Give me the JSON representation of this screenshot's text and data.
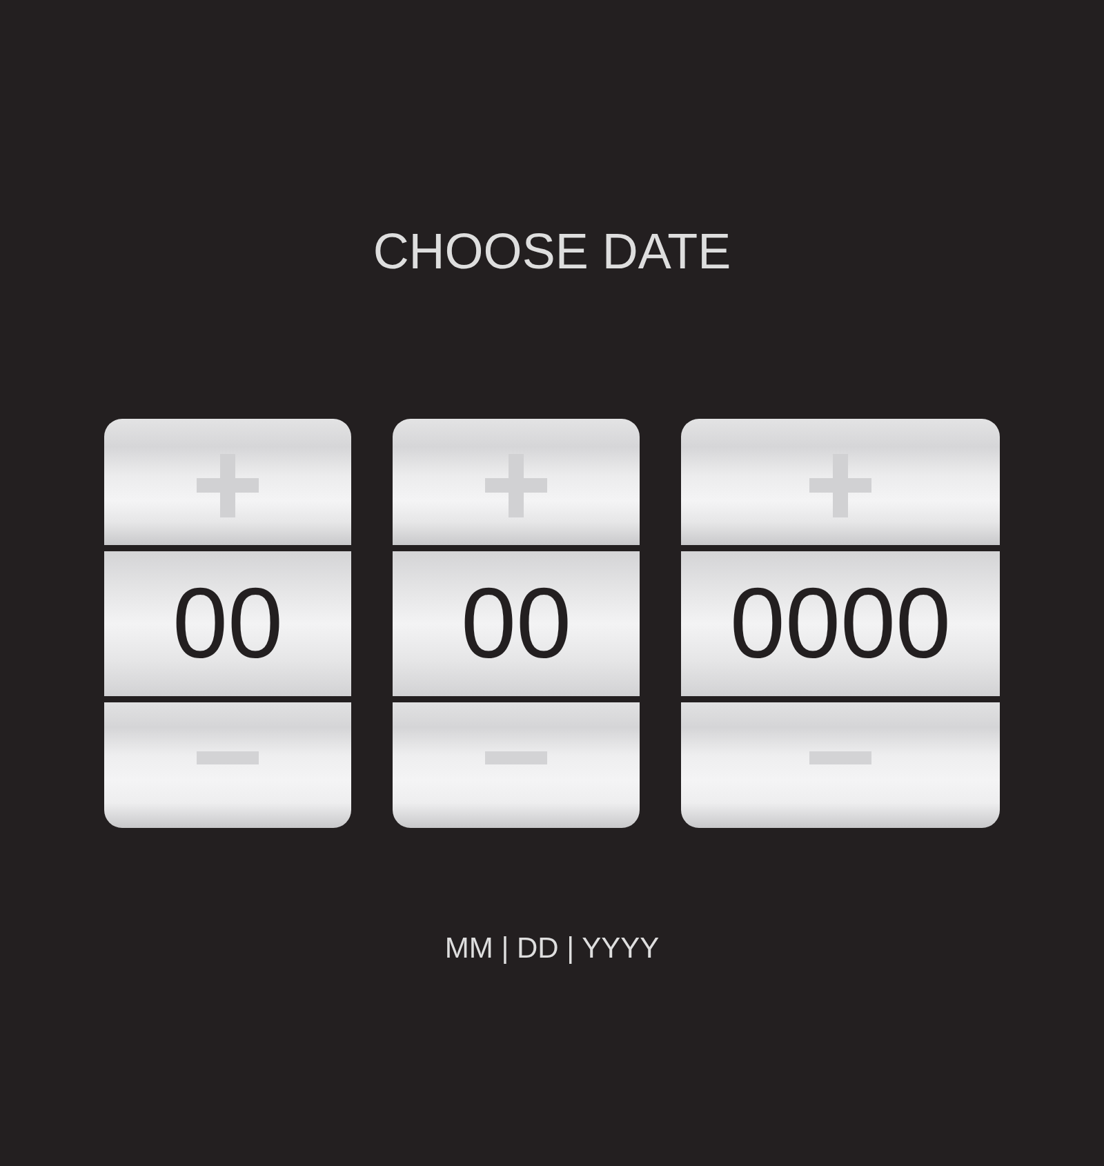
{
  "title": "CHOOSE DATE",
  "spinners": [
    {
      "value": "00"
    },
    {
      "value": "00"
    },
    {
      "value": "0000"
    }
  ],
  "format_hint": "MM | DD | YYYY"
}
